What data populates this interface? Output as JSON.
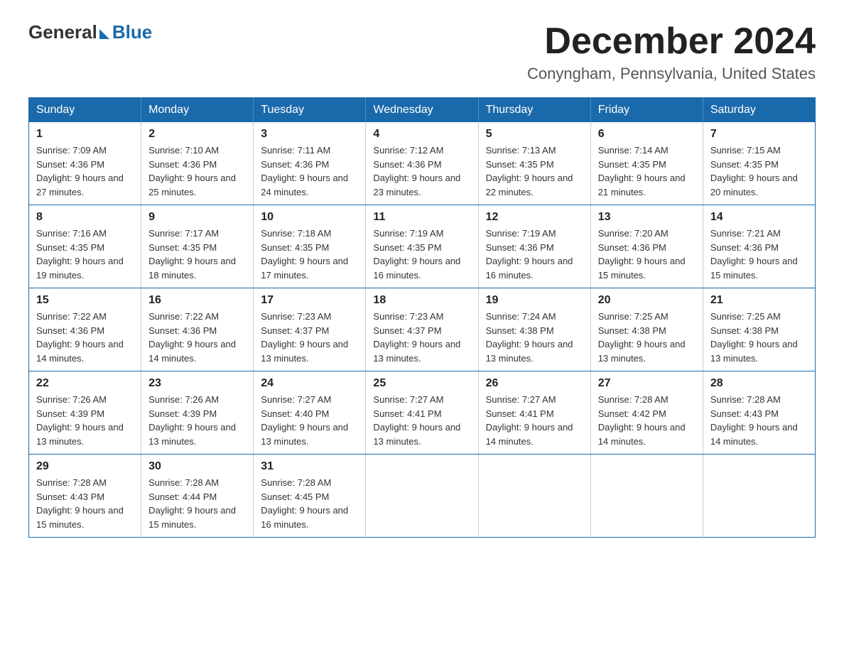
{
  "logo": {
    "general": "General",
    "blue": "Blue"
  },
  "title": {
    "month": "December 2024",
    "location": "Conyngham, Pennsylvania, United States"
  },
  "days_of_week": [
    "Sunday",
    "Monday",
    "Tuesday",
    "Wednesday",
    "Thursday",
    "Friday",
    "Saturday"
  ],
  "weeks": [
    [
      {
        "day": "1",
        "sunrise": "7:09 AM",
        "sunset": "4:36 PM",
        "daylight": "9 hours and 27 minutes."
      },
      {
        "day": "2",
        "sunrise": "7:10 AM",
        "sunset": "4:36 PM",
        "daylight": "9 hours and 25 minutes."
      },
      {
        "day": "3",
        "sunrise": "7:11 AM",
        "sunset": "4:36 PM",
        "daylight": "9 hours and 24 minutes."
      },
      {
        "day": "4",
        "sunrise": "7:12 AM",
        "sunset": "4:36 PM",
        "daylight": "9 hours and 23 minutes."
      },
      {
        "day": "5",
        "sunrise": "7:13 AM",
        "sunset": "4:35 PM",
        "daylight": "9 hours and 22 minutes."
      },
      {
        "day": "6",
        "sunrise": "7:14 AM",
        "sunset": "4:35 PM",
        "daylight": "9 hours and 21 minutes."
      },
      {
        "day": "7",
        "sunrise": "7:15 AM",
        "sunset": "4:35 PM",
        "daylight": "9 hours and 20 minutes."
      }
    ],
    [
      {
        "day": "8",
        "sunrise": "7:16 AM",
        "sunset": "4:35 PM",
        "daylight": "9 hours and 19 minutes."
      },
      {
        "day": "9",
        "sunrise": "7:17 AM",
        "sunset": "4:35 PM",
        "daylight": "9 hours and 18 minutes."
      },
      {
        "day": "10",
        "sunrise": "7:18 AM",
        "sunset": "4:35 PM",
        "daylight": "9 hours and 17 minutes."
      },
      {
        "day": "11",
        "sunrise": "7:19 AM",
        "sunset": "4:35 PM",
        "daylight": "9 hours and 16 minutes."
      },
      {
        "day": "12",
        "sunrise": "7:19 AM",
        "sunset": "4:36 PM",
        "daylight": "9 hours and 16 minutes."
      },
      {
        "day": "13",
        "sunrise": "7:20 AM",
        "sunset": "4:36 PM",
        "daylight": "9 hours and 15 minutes."
      },
      {
        "day": "14",
        "sunrise": "7:21 AM",
        "sunset": "4:36 PM",
        "daylight": "9 hours and 15 minutes."
      }
    ],
    [
      {
        "day": "15",
        "sunrise": "7:22 AM",
        "sunset": "4:36 PM",
        "daylight": "9 hours and 14 minutes."
      },
      {
        "day": "16",
        "sunrise": "7:22 AM",
        "sunset": "4:36 PM",
        "daylight": "9 hours and 14 minutes."
      },
      {
        "day": "17",
        "sunrise": "7:23 AM",
        "sunset": "4:37 PM",
        "daylight": "9 hours and 13 minutes."
      },
      {
        "day": "18",
        "sunrise": "7:23 AM",
        "sunset": "4:37 PM",
        "daylight": "9 hours and 13 minutes."
      },
      {
        "day": "19",
        "sunrise": "7:24 AM",
        "sunset": "4:38 PM",
        "daylight": "9 hours and 13 minutes."
      },
      {
        "day": "20",
        "sunrise": "7:25 AM",
        "sunset": "4:38 PM",
        "daylight": "9 hours and 13 minutes."
      },
      {
        "day": "21",
        "sunrise": "7:25 AM",
        "sunset": "4:38 PM",
        "daylight": "9 hours and 13 minutes."
      }
    ],
    [
      {
        "day": "22",
        "sunrise": "7:26 AM",
        "sunset": "4:39 PM",
        "daylight": "9 hours and 13 minutes."
      },
      {
        "day": "23",
        "sunrise": "7:26 AM",
        "sunset": "4:39 PM",
        "daylight": "9 hours and 13 minutes."
      },
      {
        "day": "24",
        "sunrise": "7:27 AM",
        "sunset": "4:40 PM",
        "daylight": "9 hours and 13 minutes."
      },
      {
        "day": "25",
        "sunrise": "7:27 AM",
        "sunset": "4:41 PM",
        "daylight": "9 hours and 13 minutes."
      },
      {
        "day": "26",
        "sunrise": "7:27 AM",
        "sunset": "4:41 PM",
        "daylight": "9 hours and 14 minutes."
      },
      {
        "day": "27",
        "sunrise": "7:28 AM",
        "sunset": "4:42 PM",
        "daylight": "9 hours and 14 minutes."
      },
      {
        "day": "28",
        "sunrise": "7:28 AM",
        "sunset": "4:43 PM",
        "daylight": "9 hours and 14 minutes."
      }
    ],
    [
      {
        "day": "29",
        "sunrise": "7:28 AM",
        "sunset": "4:43 PM",
        "daylight": "9 hours and 15 minutes."
      },
      {
        "day": "30",
        "sunrise": "7:28 AM",
        "sunset": "4:44 PM",
        "daylight": "9 hours and 15 minutes."
      },
      {
        "day": "31",
        "sunrise": "7:28 AM",
        "sunset": "4:45 PM",
        "daylight": "9 hours and 16 minutes."
      },
      null,
      null,
      null,
      null
    ]
  ],
  "labels": {
    "sunrise": "Sunrise:",
    "sunset": "Sunset:",
    "daylight": "Daylight:"
  }
}
